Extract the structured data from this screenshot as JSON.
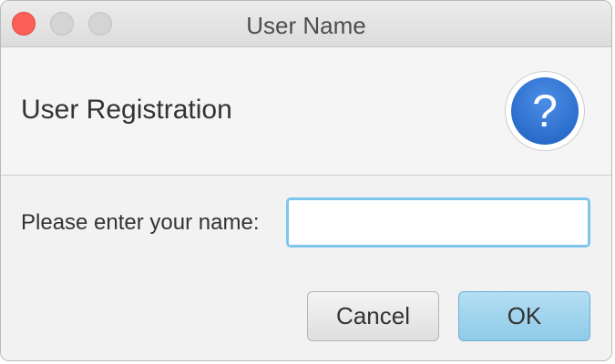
{
  "window": {
    "title": "User Name"
  },
  "header": {
    "title": "User Registration",
    "icon": "question-mark-icon",
    "icon_glyph": "?"
  },
  "form": {
    "prompt_label": "Please enter your name:",
    "name_value": "",
    "name_placeholder": ""
  },
  "buttons": {
    "cancel_label": "Cancel",
    "ok_label": "OK"
  },
  "colors": {
    "close_button": "#fc5f57",
    "help_icon": "#1e5fc0",
    "ok_button": "#8fcbe8",
    "input_focus": "#7fc6ee"
  }
}
